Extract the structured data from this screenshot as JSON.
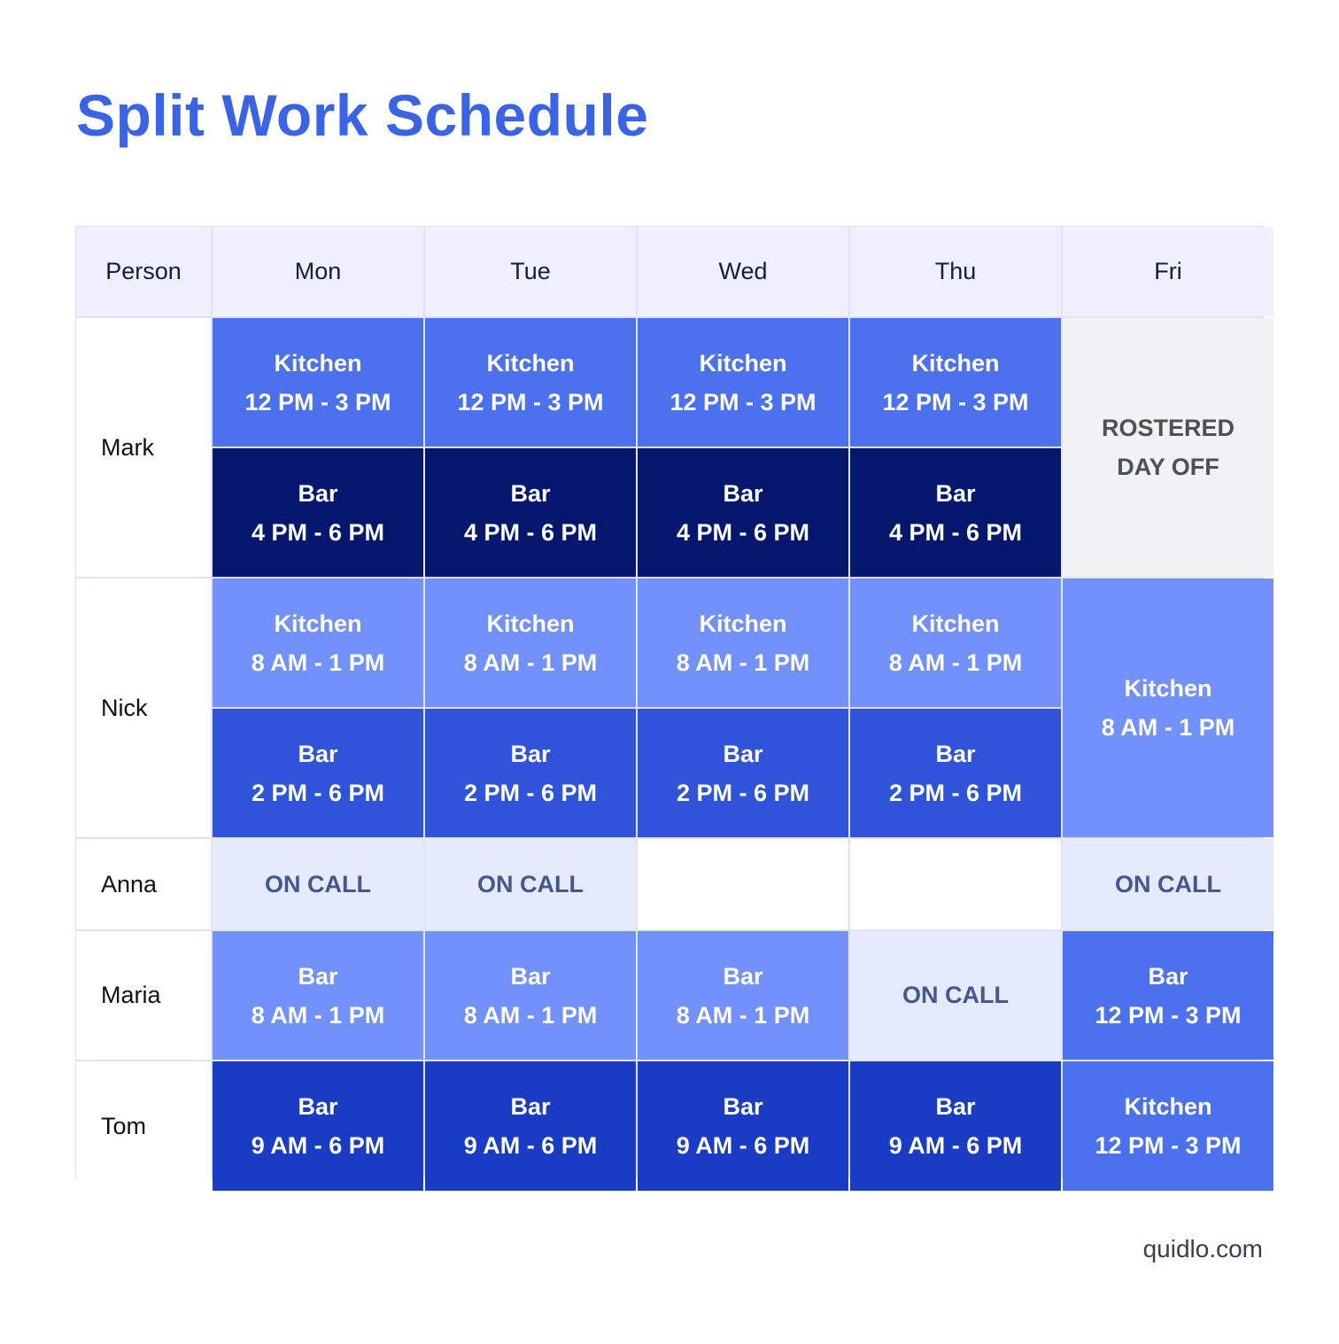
{
  "title": "Split Work Schedule",
  "columns": [
    "Person",
    "Mon",
    "Tue",
    "Wed",
    "Thu",
    "Fri"
  ],
  "rows": {
    "mark": {
      "name": "Mark",
      "kitchen": {
        "label": "Kitchen",
        "time": "12 PM - 3 PM"
      },
      "bar": {
        "label": "Bar",
        "time": "4 PM  - 6 PM"
      },
      "fri": {
        "line1": "ROSTERED",
        "line2": "DAY OFF"
      }
    },
    "nick": {
      "name": "Nick",
      "kitchen": {
        "label": "Kitchen",
        "time": "8 AM - 1 PM"
      },
      "bar": {
        "label": "Bar",
        "time": "2 PM  - 6 PM"
      },
      "fri": {
        "label": "Kitchen",
        "time": "8 AM - 1 PM"
      }
    },
    "anna": {
      "name": "Anna",
      "mon": "ON CALL",
      "tue": "ON CALL",
      "wed": "",
      "thu": "",
      "fri": "ON CALL"
    },
    "maria": {
      "name": "Maria",
      "bar": {
        "label": "Bar",
        "time": "8 AM  - 1 PM"
      },
      "thu": "ON CALL",
      "fri": {
        "label": "Bar",
        "time": "12 PM - 3 PM"
      }
    },
    "tom": {
      "name": "Tom",
      "bar": {
        "label": "Bar",
        "time": "9 AM  - 6 PM"
      },
      "fri": {
        "label": "Kitchen",
        "time": "12 PM  - 3 PM"
      }
    }
  },
  "colors": {
    "title": "#3a63e6",
    "kitchen_mid": "#4b71ef",
    "bar_dark": "#03186d",
    "kitchen_light": "#7391fc",
    "bar_mid": "#2f54d9",
    "bar_tom": "#1a3bc4",
    "on_call_bg": "#e5eafc",
    "day_off_bg": "#f1f2f4",
    "header_bg": "#eef1fd"
  },
  "footer": "quidlo.com"
}
